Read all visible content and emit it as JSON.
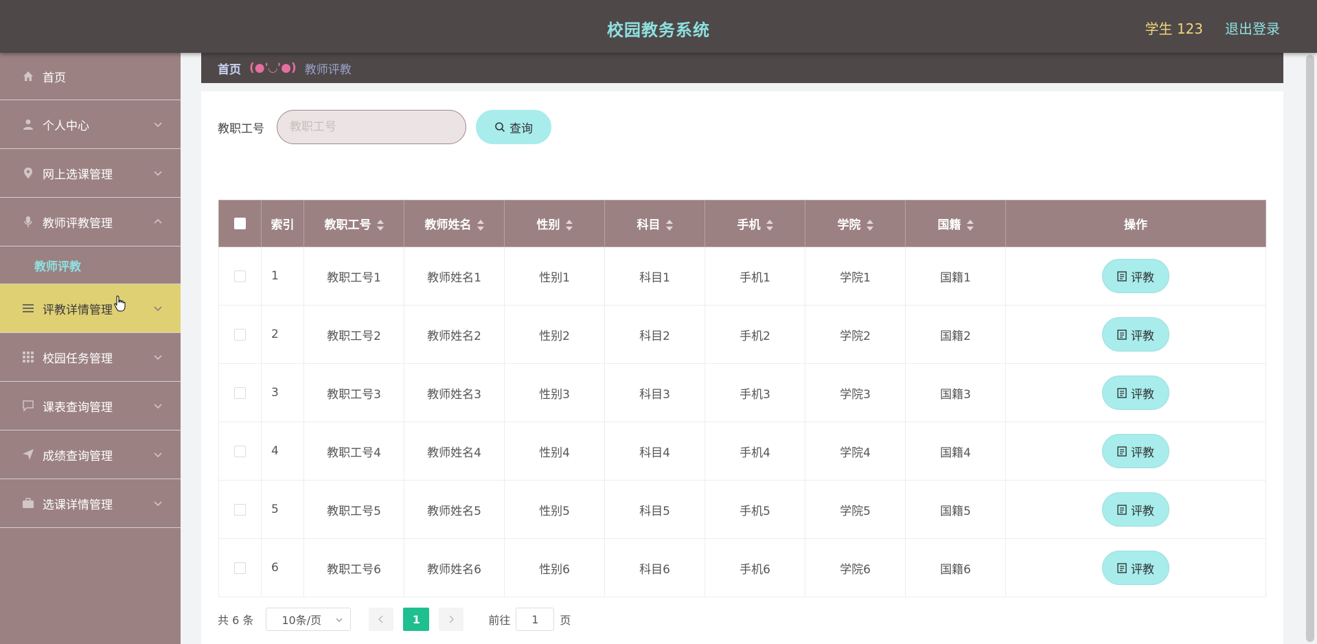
{
  "header": {
    "title": "校园教务系统",
    "user": "学生 123",
    "logout": "退出登录"
  },
  "sidebar": {
    "items": [
      {
        "label": "首页",
        "icon": "home-icon"
      },
      {
        "label": "个人中心",
        "icon": "user-icon"
      },
      {
        "label": "网上选课管理",
        "icon": "location-icon"
      },
      {
        "label": "教师评教管理",
        "icon": "mic-icon"
      },
      {
        "label": "评教详情管理",
        "icon": "menu-icon"
      },
      {
        "label": "校园任务管理",
        "icon": "grid-icon"
      },
      {
        "label": "课表查询管理",
        "icon": "chat-icon"
      },
      {
        "label": "成绩查询管理",
        "icon": "send-icon"
      },
      {
        "label": "选课详情管理",
        "icon": "suitcase-icon"
      }
    ],
    "submenu": {
      "label": "教师评教"
    }
  },
  "breadcrumb": {
    "home": "首页",
    "separator": "(●'◡'●)",
    "current": "教师评教"
  },
  "search": {
    "label": "教职工号",
    "placeholder": "教职工号",
    "value": "",
    "button": "查询"
  },
  "table": {
    "columns": [
      "索引",
      "教职工号",
      "教师姓名",
      "性别",
      "科目",
      "手机",
      "学院",
      "国籍",
      "操作"
    ],
    "action_label": "评教",
    "rows": [
      {
        "index": "1",
        "job_no": "教职工号1",
        "name": "教师姓名1",
        "gender": "性别1",
        "subject": "科目1",
        "phone": "手机1",
        "college": "学院1",
        "nationality": "国籍1"
      },
      {
        "index": "2",
        "job_no": "教职工号2",
        "name": "教师姓名2",
        "gender": "性别2",
        "subject": "科目2",
        "phone": "手机2",
        "college": "学院2",
        "nationality": "国籍2"
      },
      {
        "index": "3",
        "job_no": "教职工号3",
        "name": "教师姓名3",
        "gender": "性别3",
        "subject": "科目3",
        "phone": "手机3",
        "college": "学院3",
        "nationality": "国籍3"
      },
      {
        "index": "4",
        "job_no": "教职工号4",
        "name": "教师姓名4",
        "gender": "性别4",
        "subject": "科目4",
        "phone": "手机4",
        "college": "学院4",
        "nationality": "国籍4"
      },
      {
        "index": "5",
        "job_no": "教职工号5",
        "name": "教师姓名5",
        "gender": "性别5",
        "subject": "科目5",
        "phone": "手机5",
        "college": "学院5",
        "nationality": "国籍5"
      },
      {
        "index": "6",
        "job_no": "教职工号6",
        "name": "教师姓名6",
        "gender": "性别6",
        "subject": "科目6",
        "phone": "手机6",
        "college": "学院6",
        "nationality": "国籍6"
      }
    ]
  },
  "pagination": {
    "total": "共 6 条",
    "page_size": "10条/页",
    "current_page": "1",
    "goto_prefix": "前往",
    "goto_value": "1",
    "goto_suffix": "页"
  },
  "colors": {
    "header_bg": "#4e4849",
    "sidebar_bg": "#9b8182",
    "active_item": "#e0d074",
    "accent_cyan": "#a8ecec",
    "page_active": "#1fbf8f"
  }
}
